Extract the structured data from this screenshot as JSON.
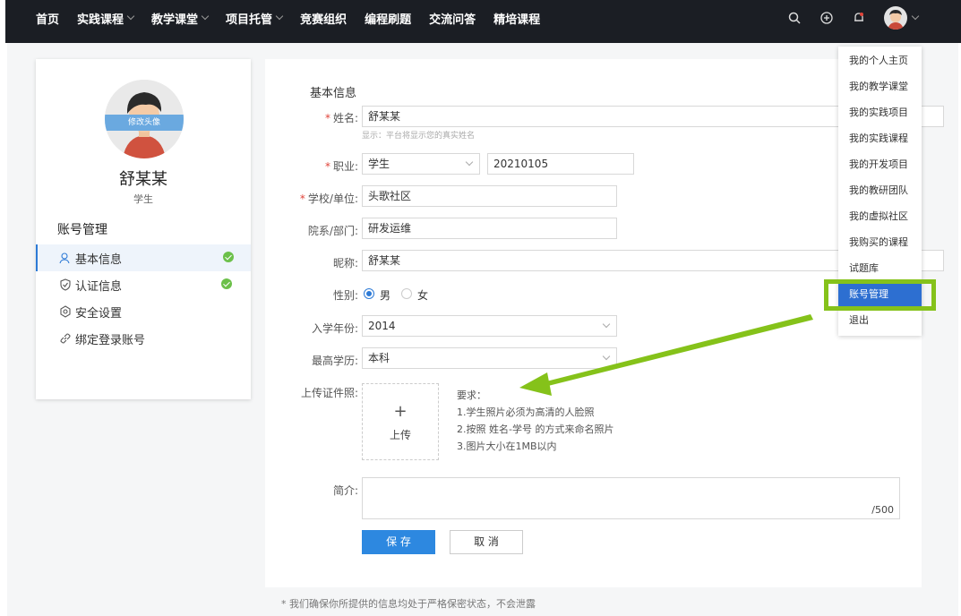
{
  "nav": {
    "items": [
      {
        "label": "首页",
        "has_dropdown": false
      },
      {
        "label": "实践课程",
        "has_dropdown": true
      },
      {
        "label": "教学课堂",
        "has_dropdown": true
      },
      {
        "label": "项目托管",
        "has_dropdown": true
      },
      {
        "label": "竞赛组织",
        "has_dropdown": false
      },
      {
        "label": "编程刷题",
        "has_dropdown": false
      },
      {
        "label": "交流问答",
        "has_dropdown": false
      },
      {
        "label": "精培课程",
        "has_dropdown": false
      }
    ]
  },
  "topbar_icons": [
    "search-icon",
    "add-circle-icon",
    "bell-icon",
    "avatar"
  ],
  "profile": {
    "avatar_overlay": "修改头像",
    "name": "舒某某",
    "role": "学生"
  },
  "sidebar": {
    "title": "账号管理",
    "items": [
      {
        "label": "基本信息",
        "icon": "user-icon",
        "verified": true
      },
      {
        "label": "认证信息",
        "icon": "shield-icon",
        "verified": true
      },
      {
        "label": "安全设置",
        "icon": "gear-icon",
        "verified": false
      },
      {
        "label": "绑定登录账号",
        "icon": "link-icon",
        "verified": false
      }
    ]
  },
  "form": {
    "section_title": "基本信息",
    "name_label": "姓名:",
    "name_value": "舒某某",
    "name_hint": "显示：平台将显示您的真实姓名",
    "job_label": "职业:",
    "job_value": "学生",
    "job_id_value": "20210105",
    "school_label": "学校/单位:",
    "school_value": "头歌社区",
    "dept_label": "院系/部门:",
    "dept_value": "研发运维",
    "nick_label": "昵称:",
    "nick_value": "舒某某",
    "gender_label": "性别:",
    "gender_male": "男",
    "gender_female": "女",
    "year_label": "入学年份:",
    "year_value": "2014",
    "edu_label": "最高学历:",
    "edu_value": "本科",
    "upload_label": "上传证件照:",
    "upload_plus": "+",
    "upload_text": "上传",
    "req_title": "要求：",
    "req_1": "1.学生照片必须为高清的人脸照",
    "req_2": "2.按照 姓名-学号 的方式来命名照片",
    "req_3": "3.图片大小在1MB以内",
    "intro_label": "简介:",
    "intro_counter": "/500",
    "save_label": "保 存",
    "cancel_label": "取 消"
  },
  "footer_note": "* 我们确保你所提供的信息均处于严格保密状态，不会泄露",
  "dropdown": {
    "items": [
      "我的个人主页",
      "我的教学课堂",
      "我的实践项目",
      "我的实践课程",
      "我的开发项目",
      "我的教研团队",
      "我的虚拟社区",
      "我购买的课程",
      "试题库",
      "账号管理",
      "退出"
    ],
    "highlighted": "账号管理"
  },
  "colors": {
    "topbar": "#1b1e24",
    "accent": "#2d88e0",
    "highlight_box": "#85c21a",
    "check": "#6cc04a",
    "required": "#e0443a"
  }
}
